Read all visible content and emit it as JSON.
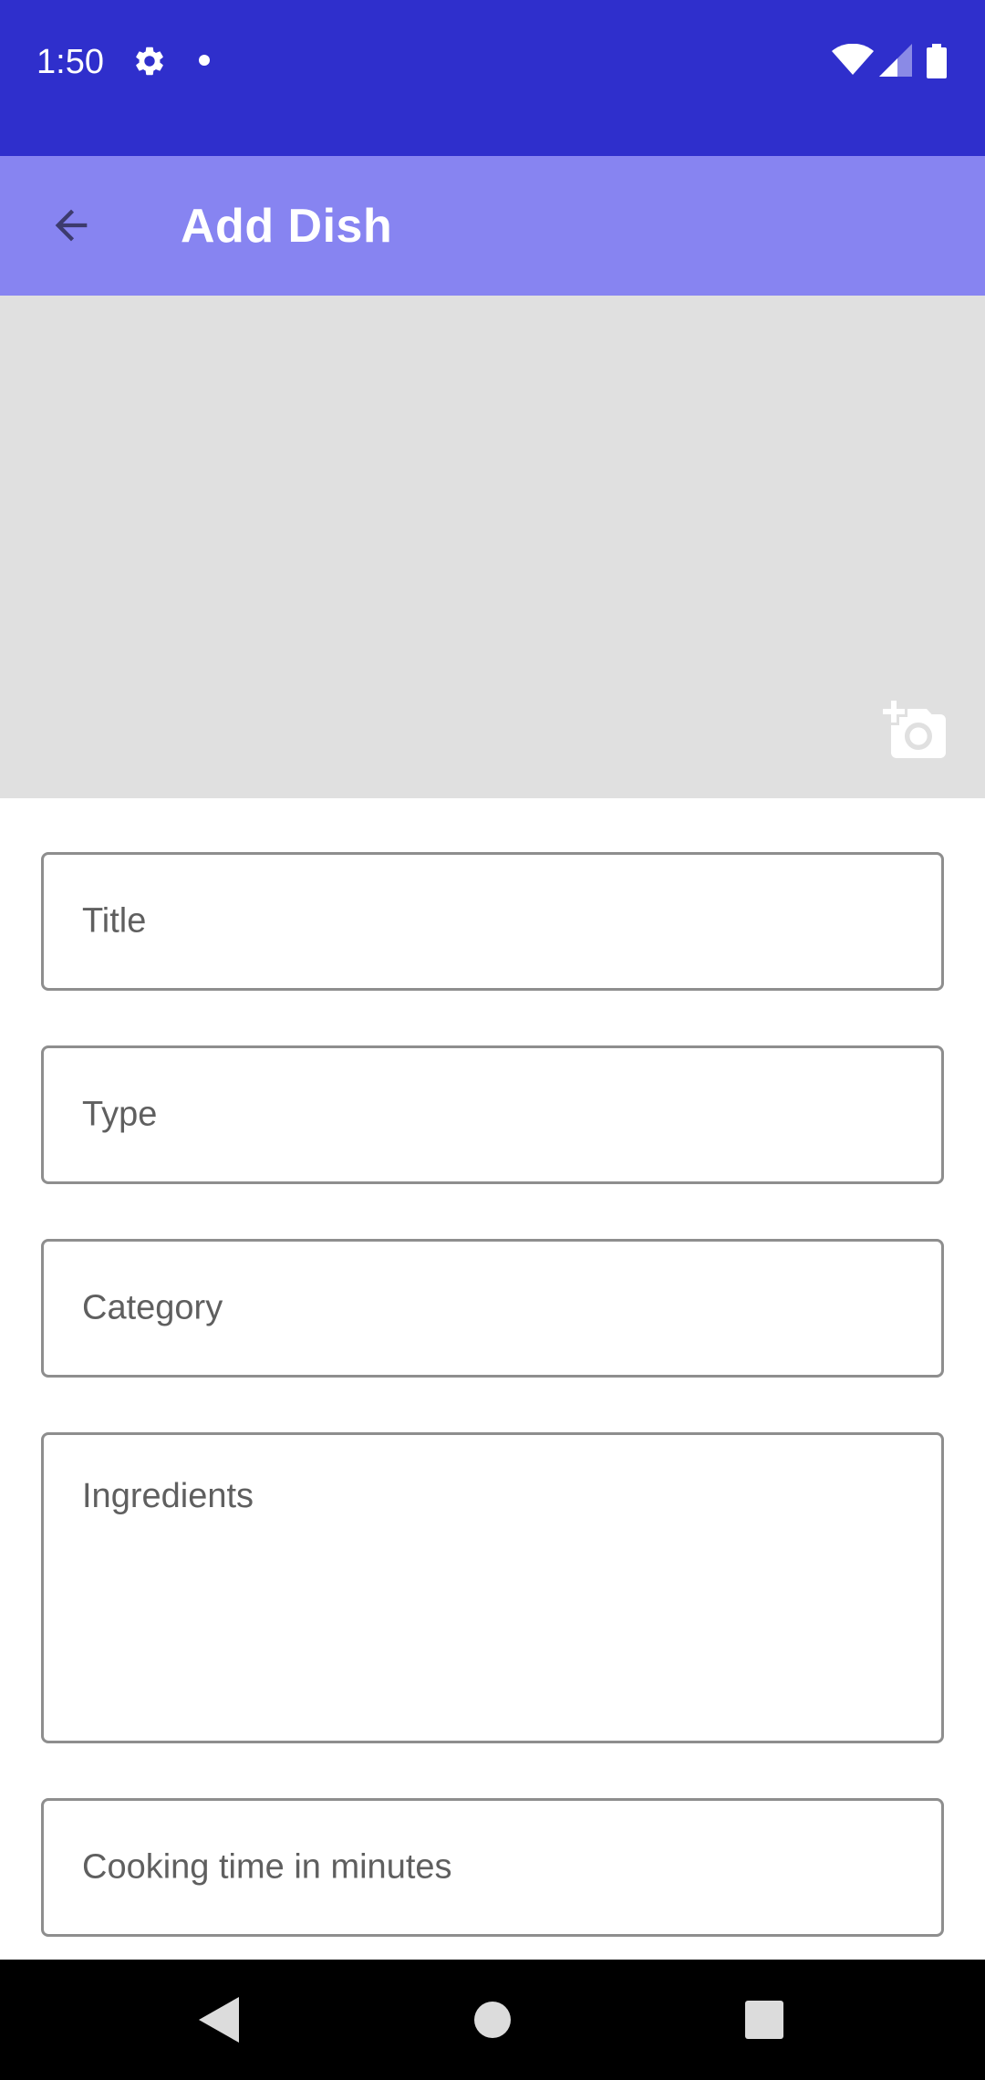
{
  "status_bar": {
    "time": "1:50",
    "icons": [
      "settings-gear-icon",
      "notification-dot-icon",
      "wifi-icon",
      "cellular-signal-icon",
      "battery-icon"
    ],
    "background": "#2f2fcc"
  },
  "app_bar": {
    "title": "Add Dish",
    "back_icon": "arrow-back-icon",
    "background": "#8784f1"
  },
  "image_area": {
    "background": "#e0e0e0",
    "action_icon": "add-photo-camera-icon"
  },
  "form": {
    "title_placeholder": "Title",
    "type_placeholder": "Type",
    "category_placeholder": "Category",
    "ingredients_placeholder": "Ingredients",
    "cooking_time_placeholder": "Cooking time in minutes"
  },
  "nav_bar": {
    "icons": [
      "nav-back-icon",
      "nav-home-icon",
      "nav-recents-icon"
    ]
  }
}
